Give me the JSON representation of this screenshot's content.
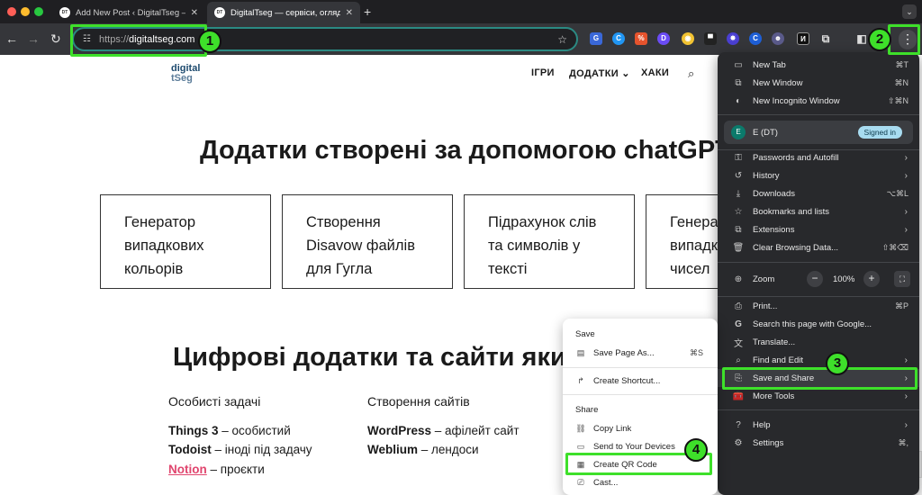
{
  "browser": {
    "tabs": [
      {
        "title": "Add New Post ‹ DigitalTseg —",
        "favicon": "wordpress-favicon",
        "active": false
      },
      {
        "title": "DigitalTseg — сервіси, огляд",
        "favicon": "digitaltseg-favicon",
        "active": true
      }
    ],
    "new_tab": "+",
    "tab_search": "⌄",
    "url_scheme": "https://",
    "url_host": "digitaltseg.com",
    "back": "←",
    "forward": "→",
    "reload": "↻",
    "star": "☆",
    "kebab": "⋮"
  },
  "page": {
    "logo_line1": "digital",
    "logo_line2": "tSeg",
    "nav": [
      "ІГРИ",
      "ДОДАТКИ ⌄",
      "ХАКИ"
    ],
    "heading1": "Додатки створені за допомогою chatGPT",
    "cards": [
      [
        "Генератор",
        "випадкових",
        "кольорів"
      ],
      [
        "Створення",
        "Disavow файлів",
        "для Гугла"
      ],
      [
        "Підрахунок слів",
        "та символів у",
        "тексті"
      ],
      [
        "Генера",
        "випадк",
        "чисел"
      ]
    ],
    "heading2": "Цифрові додатки та сайти яким",
    "col1_title": "Особисті задачі",
    "col2_title": "Створення сайтів",
    "col1": [
      {
        "name": "Things 3",
        "desc": " – особистий"
      },
      {
        "name": "Todoist",
        "desc": " – іноді під задачу"
      },
      {
        "name": "Notion",
        "desc": " – проєкти"
      }
    ],
    "col2": [
      {
        "name": "WordPress",
        "desc": " – афілейт сайт"
      },
      {
        "name": "Weblium",
        "desc": " – лендоси"
      }
    ]
  },
  "menu": {
    "items_top": [
      {
        "label": "New Tab",
        "kbd": "⌘T",
        "icon": "new-tab-icon"
      },
      {
        "label": "New Window",
        "kbd": "⌘N",
        "icon": "new-window-icon"
      },
      {
        "label": "New Incognito Window",
        "kbd": "⇧⌘N",
        "icon": "incognito-icon"
      }
    ],
    "profile_initial": "E",
    "profile_name": "E (DT)",
    "signed_in": "Signed in",
    "items_mid": [
      {
        "label": "Passwords and Autofill",
        "kbd": "›"
      },
      {
        "label": "History",
        "kbd": "›"
      },
      {
        "label": "Downloads",
        "kbd": "⌥⌘L"
      },
      {
        "label": "Bookmarks and lists",
        "kbd": "›"
      },
      {
        "label": "Extensions",
        "kbd": "›"
      },
      {
        "label": "Clear Browsing Data...",
        "kbd": "⇧⌘⌫"
      }
    ],
    "zoom_label": "Zoom",
    "zoom_minus": "−",
    "zoom_value": "100%",
    "zoom_plus": "+",
    "items_tools": [
      {
        "label": "Print...",
        "kbd": "⌘P"
      },
      {
        "label": "Search this page with Google...",
        "kbd": ""
      },
      {
        "label": "Translate...",
        "kbd": ""
      },
      {
        "label": "Find and Edit",
        "kbd": "›"
      },
      {
        "label": "Save and Share",
        "kbd": "›"
      },
      {
        "label": "More Tools",
        "kbd": "›"
      }
    ],
    "items_bottom": [
      {
        "label": "Help",
        "kbd": "›"
      },
      {
        "label": "Settings",
        "kbd": "⌘,"
      }
    ]
  },
  "submenu": {
    "save_header": "Save",
    "save_page": "Save Page As...",
    "save_page_kbd": "⌘S",
    "create_shortcut": "Create Shortcut...",
    "share_header": "Share",
    "copy_link": "Copy Link",
    "send_devices": "Send to Your Devices",
    "qr_code": "Create QR Code",
    "cast": "Cast..."
  },
  "annotations": {
    "step1": "1",
    "step2": "2",
    "step3": "3",
    "step4": "4",
    "color": "#3ee02a"
  }
}
